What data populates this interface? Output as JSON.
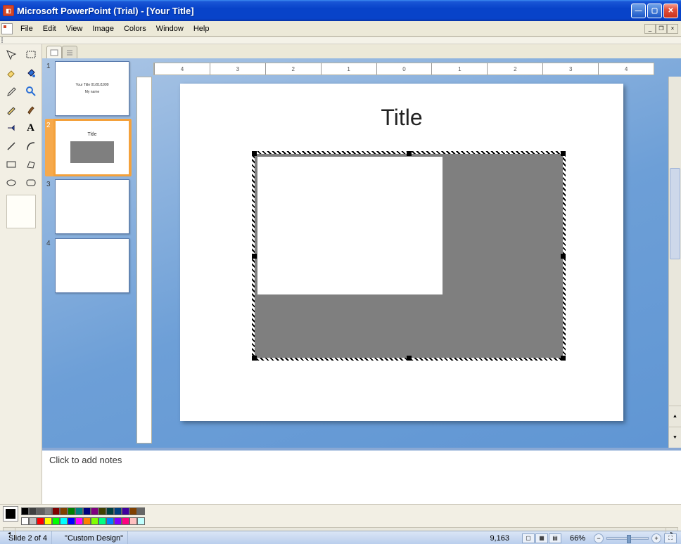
{
  "title": "Microsoft PowerPoint (Trial) - [Your Title]",
  "menus": {
    "file": "File",
    "edit": "Edit",
    "view": "View",
    "image": "Image",
    "colors": "Colors",
    "window": "Window",
    "help": "Help"
  },
  "slide": {
    "title": "Title"
  },
  "thumbs": {
    "s1": {
      "line1": "Your Title 01/01/1999",
      "line2": "My name"
    },
    "s2": {
      "title": "Title"
    }
  },
  "notes_placeholder": "Click to add notes",
  "ruler": {
    "marks": [
      "4",
      "3",
      "2",
      "1",
      "0",
      "1",
      "2",
      "3",
      "4"
    ]
  },
  "status": {
    "slide": "Slide 2 of 4",
    "design": "\"Custom Design\"",
    "coords": "9,163",
    "zoom": "66%"
  },
  "palette": {
    "row1": [
      "#000000",
      "#404040",
      "#606060",
      "#808080",
      "#800000",
      "#804000",
      "#008000",
      "#008080",
      "#000080",
      "#800080",
      "#404000",
      "#004040",
      "#004080",
      "#4000a0",
      "#804000",
      "#666666"
    ],
    "row2": [
      "#ffffff",
      "#c0c0c0",
      "#ff0000",
      "#ffff00",
      "#00ff00",
      "#00ffff",
      "#0000ff",
      "#ff00ff",
      "#ff8000",
      "#80ff00",
      "#00ff80",
      "#0080ff",
      "#8000ff",
      "#ff0080",
      "#ffc0c0",
      "#c0ffff"
    ]
  }
}
